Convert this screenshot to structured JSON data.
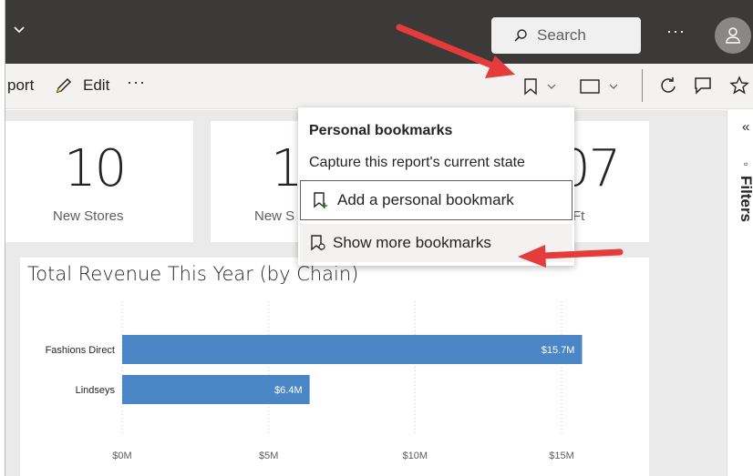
{
  "search": {
    "label": "Search"
  },
  "topbar": {
    "more": "···"
  },
  "actionbar": {
    "report_label": "port",
    "edit_label": "Edit",
    "more": "···"
  },
  "cards": [
    {
      "value": "10",
      "label": "New Stores"
    },
    {
      "value": "1",
      "label": "New S"
    },
    {
      "value": "07",
      "label": "Ft"
    }
  ],
  "bookmarks_menu": {
    "title": "Personal bookmarks",
    "subtitle": "Capture this report's current state",
    "add": "Add a personal bookmark",
    "show_more": "Show more bookmarks"
  },
  "filters": {
    "collapse": "«",
    "label": "Filters"
  },
  "colors": {
    "bar": "#4a86c5",
    "accent_arrow": "#e63b3b",
    "topbar": "#3b3a39"
  },
  "chart_data": {
    "type": "bar",
    "orientation": "horizontal",
    "title": "Total Revenue This Year (by Chain)",
    "categories": [
      "Fashions Direct",
      "Lindseys"
    ],
    "values": [
      15.7,
      6.4
    ],
    "data_labels": [
      "$15.7M",
      "$6.4M"
    ],
    "xticks": [
      "$0M",
      "$5M",
      "$10M",
      "$15M"
    ],
    "xlim": [
      0,
      15.7
    ],
    "unit": "M",
    "grid": true
  }
}
